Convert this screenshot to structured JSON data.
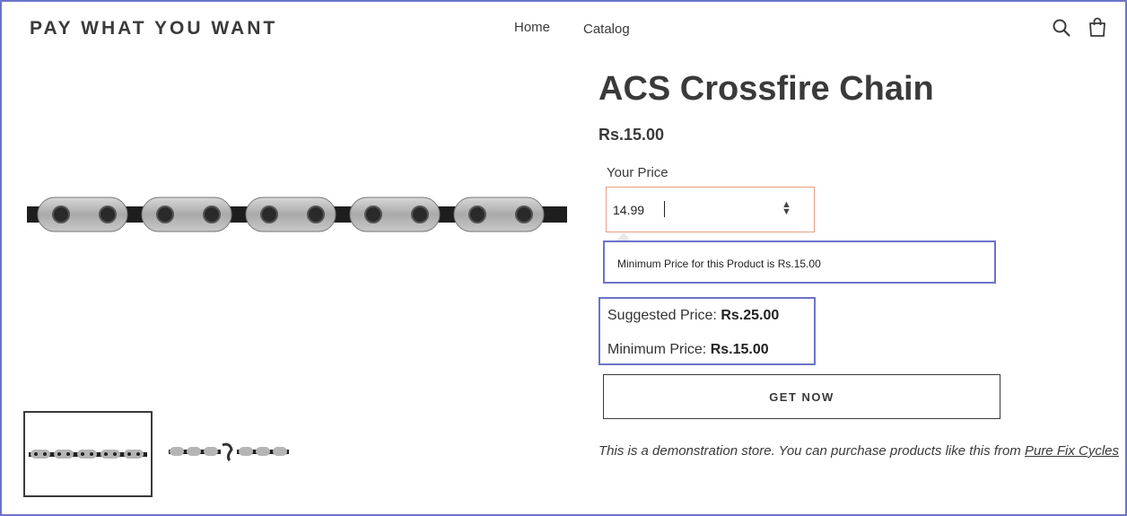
{
  "header": {
    "brand": "PAY WHAT YOU WANT",
    "nav": [
      {
        "label": "Home"
      },
      {
        "label": "Catalog"
      }
    ],
    "icons": [
      "search-icon",
      "cart-icon"
    ]
  },
  "product": {
    "title": "ACS Crossfire Chain",
    "price": "Rs.15.00",
    "your_price_label": "Your Price",
    "your_price_value": "14.99",
    "validation_message": "Minimum Price for this Product is Rs.15.00",
    "suggested_label": "Suggested Price:",
    "suggested_value": "Rs.25.00",
    "minimum_label": "Minimum Price:",
    "minimum_value": "Rs.15.00",
    "button_label": "GET NOW",
    "note_text": "This is a demonstration store. You can purchase products like this from ",
    "note_link": "Pure Fix Cycles"
  },
  "colors": {
    "highlight_border": "#6b74c9",
    "input_error_border": "#e79e85",
    "text": "#3a3a3a"
  }
}
